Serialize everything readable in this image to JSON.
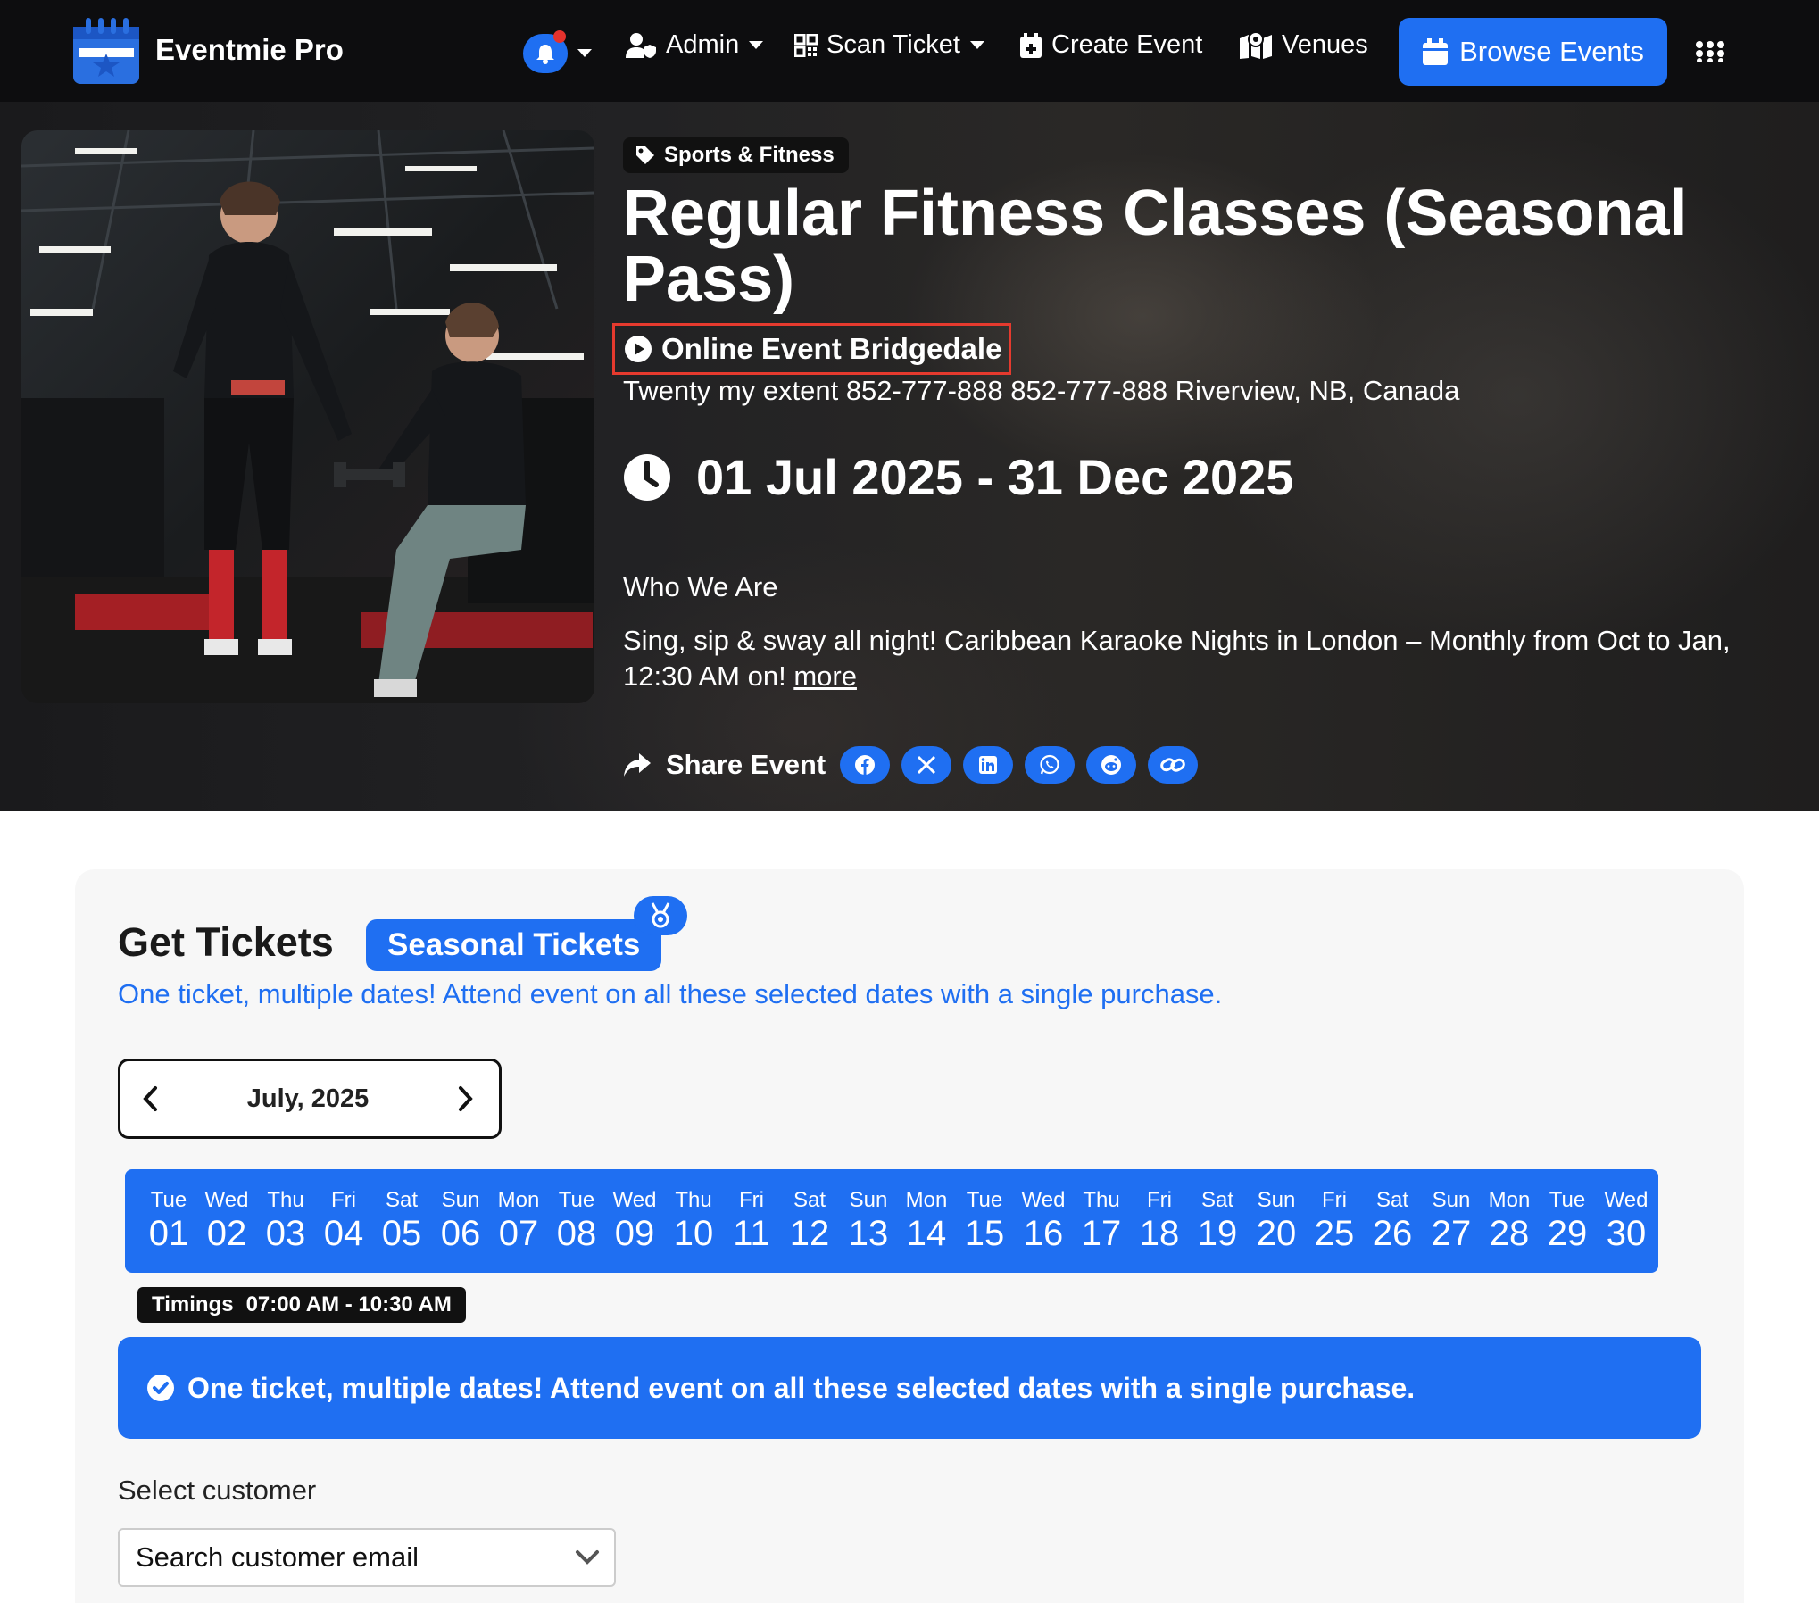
{
  "navbar": {
    "brand": "Eventmie Pro",
    "admin_label": "Admin",
    "scan_label": "Scan Ticket",
    "create_label": "Create Event",
    "venues_label": "Venues",
    "browse_label": "Browse Events",
    "accent_color": "#1f6ff2"
  },
  "event": {
    "category": "Sports & Fitness",
    "title": "Regular Fitness Classes (Seasonal Pass)",
    "venue": "Online Event Bridgedale",
    "address": "Twenty my extent 852-777-888 852-777-888 Riverview, NB, Canada",
    "date_range": "01 Jul 2025 - 31 Dec 2025",
    "about_heading": "Who We Are",
    "about_text": "Sing, sip & sway all night! Caribbean Karaoke Nights in London – Monthly from Oct to Jan, 12:30 AM on!",
    "more_link": "more",
    "share_label": "Share Event"
  },
  "tickets": {
    "heading": "Get Tickets",
    "badge": "Seasonal Tickets",
    "subtitle": "One ticket, multiple dates! Attend event on all these selected dates with a single purchase.",
    "month": "July, 2025",
    "dates": [
      {
        "dow": "Tue",
        "day": "01"
      },
      {
        "dow": "Wed",
        "day": "02"
      },
      {
        "dow": "Thu",
        "day": "03"
      },
      {
        "dow": "Fri",
        "day": "04"
      },
      {
        "dow": "Sat",
        "day": "05"
      },
      {
        "dow": "Sun",
        "day": "06"
      },
      {
        "dow": "Mon",
        "day": "07"
      },
      {
        "dow": "Tue",
        "day": "08"
      },
      {
        "dow": "Wed",
        "day": "09"
      },
      {
        "dow": "Thu",
        "day": "10"
      },
      {
        "dow": "Fri",
        "day": "11"
      },
      {
        "dow": "Sat",
        "day": "12"
      },
      {
        "dow": "Sun",
        "day": "13"
      },
      {
        "dow": "Mon",
        "day": "14"
      },
      {
        "dow": "Tue",
        "day": "15"
      },
      {
        "dow": "Wed",
        "day": "16"
      },
      {
        "dow": "Thu",
        "day": "17"
      },
      {
        "dow": "Fri",
        "day": "18"
      },
      {
        "dow": "Sat",
        "day": "19"
      },
      {
        "dow": "Sun",
        "day": "20"
      },
      {
        "dow": "Fri",
        "day": "25"
      },
      {
        "dow": "Sat",
        "day": "26"
      },
      {
        "dow": "Sun",
        "day": "27"
      },
      {
        "dow": "Mon",
        "day": "28"
      },
      {
        "dow": "Tue",
        "day": "29"
      },
      {
        "dow": "Wed",
        "day": "30"
      }
    ],
    "timings_label": "Timings",
    "timings_value": "07:00 AM - 10:30 AM",
    "info_message": "One ticket, multiple dates! Attend event on all these selected dates with a single purchase.",
    "select_customer_label": "Select customer",
    "select_customer_placeholder": "Search customer email"
  }
}
